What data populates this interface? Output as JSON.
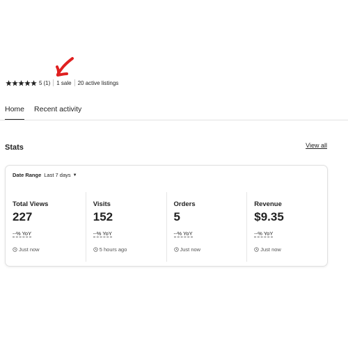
{
  "shop": {
    "rating": "5",
    "review_count": "(1)",
    "sales": "1 sale",
    "listings": "20 active listings",
    "star_count": 5
  },
  "tabs": [
    {
      "label": "Home",
      "active": true
    },
    {
      "label": "Recent activity",
      "active": false
    }
  ],
  "stats": {
    "title": "Stats",
    "view_all": "View all",
    "date_range_label": "Date Range",
    "date_range_value": "Last 7 days",
    "metrics": [
      {
        "label": "Total Views",
        "value": "227",
        "yoy": "--% YoY",
        "updated": "Just now"
      },
      {
        "label": "Visits",
        "value": "152",
        "yoy": "--% YoY",
        "updated": "5 hours ago"
      },
      {
        "label": "Orders",
        "value": "5",
        "yoy": "--% YoY",
        "updated": "Just now"
      },
      {
        "label": "Revenue",
        "value": "$9.35",
        "yoy": "--% YoY",
        "updated": "Just now"
      }
    ]
  },
  "colors": {
    "annotation": "#e02020",
    "text": "#222222",
    "divider": "#e1e1e1"
  }
}
